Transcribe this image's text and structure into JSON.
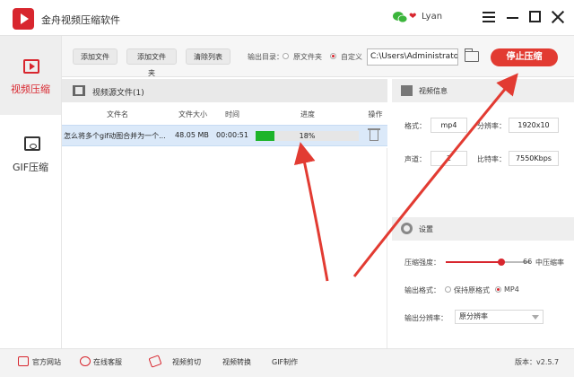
{
  "window": {
    "app_title": "金舟视频压缩软件",
    "username": "Lyan"
  },
  "sidebar": {
    "items": [
      {
        "label": "视频压缩",
        "icon": "video-icon",
        "active": true
      },
      {
        "label": "GIF压缩",
        "icon": "gif-icon",
        "active": false
      }
    ]
  },
  "toolbar": {
    "add_file": "添加文件",
    "add_folder": "添加文件夹",
    "clear_list": "清除列表",
    "output_label": "输出目录：",
    "option_source": "原文件夹",
    "option_custom": "自定义",
    "output_path": "C:\\Users\\Administrator\\",
    "stop_button": "停止压缩"
  },
  "file_list": {
    "title": "视频源文件(1)",
    "columns": [
      "文件名",
      "文件大小",
      "时间",
      "进度",
      "操作"
    ],
    "rows": [
      {
        "name": "怎么将多个gif动图合并为一个...",
        "size": "48.05 MB",
        "time": "00:00:51",
        "progress_text": "18%",
        "progress": 0.18
      }
    ]
  },
  "video_info": {
    "title": "视频信息",
    "format_label": "格式：",
    "format_value": "mp4",
    "resolution_label": "分辨率：",
    "resolution_value": "1920x10",
    "channel_label": "声道：",
    "channel_value": "2",
    "bitrate_label": "比特率：",
    "bitrate_value": "7550Kbps"
  },
  "settings": {
    "title": "设置",
    "strength_label": "压缩强度：",
    "strength_value": 66,
    "strength_text": "66",
    "strength_desc": "中压缩率",
    "out_format_label": "输出格式：",
    "keep_format": "保持原格式",
    "mp4_option": "MP4",
    "out_resolution_label": "输出分辨率：",
    "out_resolution_value": "原分辨率"
  },
  "footer": {
    "official_site": "官方网站",
    "online_service": "在线客服",
    "video_cut": "视频剪切",
    "video_convert": "视频转换",
    "gif_make": "GIF制作",
    "version": "版本：v2.5.7"
  },
  "colors": {
    "accent": "#d8262e",
    "progress": "#1db42a",
    "selected_row": "#dbe9f9"
  }
}
